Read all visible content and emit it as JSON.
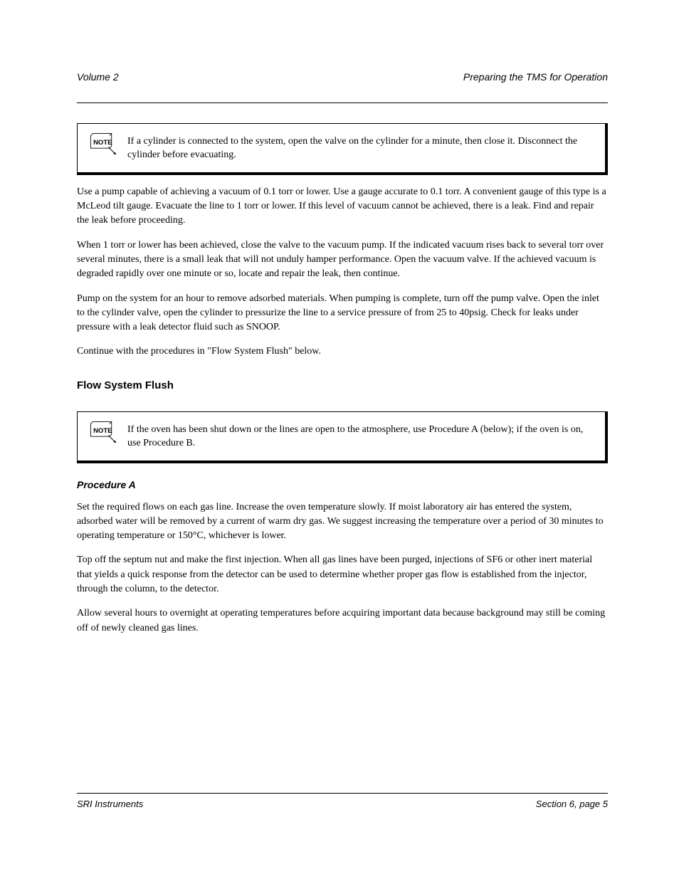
{
  "header": {
    "left": "Volume 2",
    "right": "Preparing the TMS for Operation"
  },
  "notes": [
    {
      "text": "If a cylinder is connected to the system, open the valve on the cylinder for a minute, then close it. Disconnect the cylinder before evacuating."
    },
    {
      "text": "If the oven has been shut down or the lines are open to the atmosphere, use Procedure A (below); if the oven is on, use Procedure B."
    }
  ],
  "paragraphs": {
    "p1": "Use a pump capable of achieving a vacuum of 0.1 torr or lower. Use a gauge accurate to 0.1 torr. A convenient gauge of this type is a McLeod tilt gauge. Evacuate the line to 1 torr or lower. If this level of vacuum cannot be achieved, there is a leak. Find and repair the leak before proceeding.",
    "p2": "When 1 torr or lower has been achieved, close the valve to the vacuum pump. If the indicated vacuum rises back to several torr over several minutes, there is a small leak that will not unduly hamper performance. Open the vacuum valve. If the achieved vacuum is degraded rapidly over one minute or so, locate and repair the leak, then continue.",
    "p3": "Pump on the system for an hour to remove adsorbed materials. When pumping is complete, turn off the pump valve. Open the inlet to the cylinder valve, open the cylinder to pressurize the line to a service pressure of from 25 to 40psig. Check for leaks under pressure with a leak detector fluid such as SNOOP.",
    "p4": "Continue with the procedures in \"Flow System Flush\" below."
  },
  "heading": "Flow System Flush",
  "sub": {
    "title": "Procedure A",
    "p1": "Set the required flows on each gas line. Increase the oven temperature slowly. If moist laboratory air has entered the system, adsorbed water will be removed by a current of warm dry gas. We suggest increasing the temperature over a period of 30 minutes to operating temperature or 150°C, whichever is lower.",
    "p2": "Top off the septum nut and make the first injection. When all gas lines have been purged, injections of SF6 or other inert material that yields a quick response from the detector can be used to determine whether proper gas flow is established from the injector, through the column, to the detector.",
    "p3": "Allow several hours to overnight at operating temperatures before acquiring important data because background may still be coming off of newly cleaned gas lines."
  },
  "footer": {
    "left": "SRI Instruments",
    "right": "Section 6, page 5"
  }
}
